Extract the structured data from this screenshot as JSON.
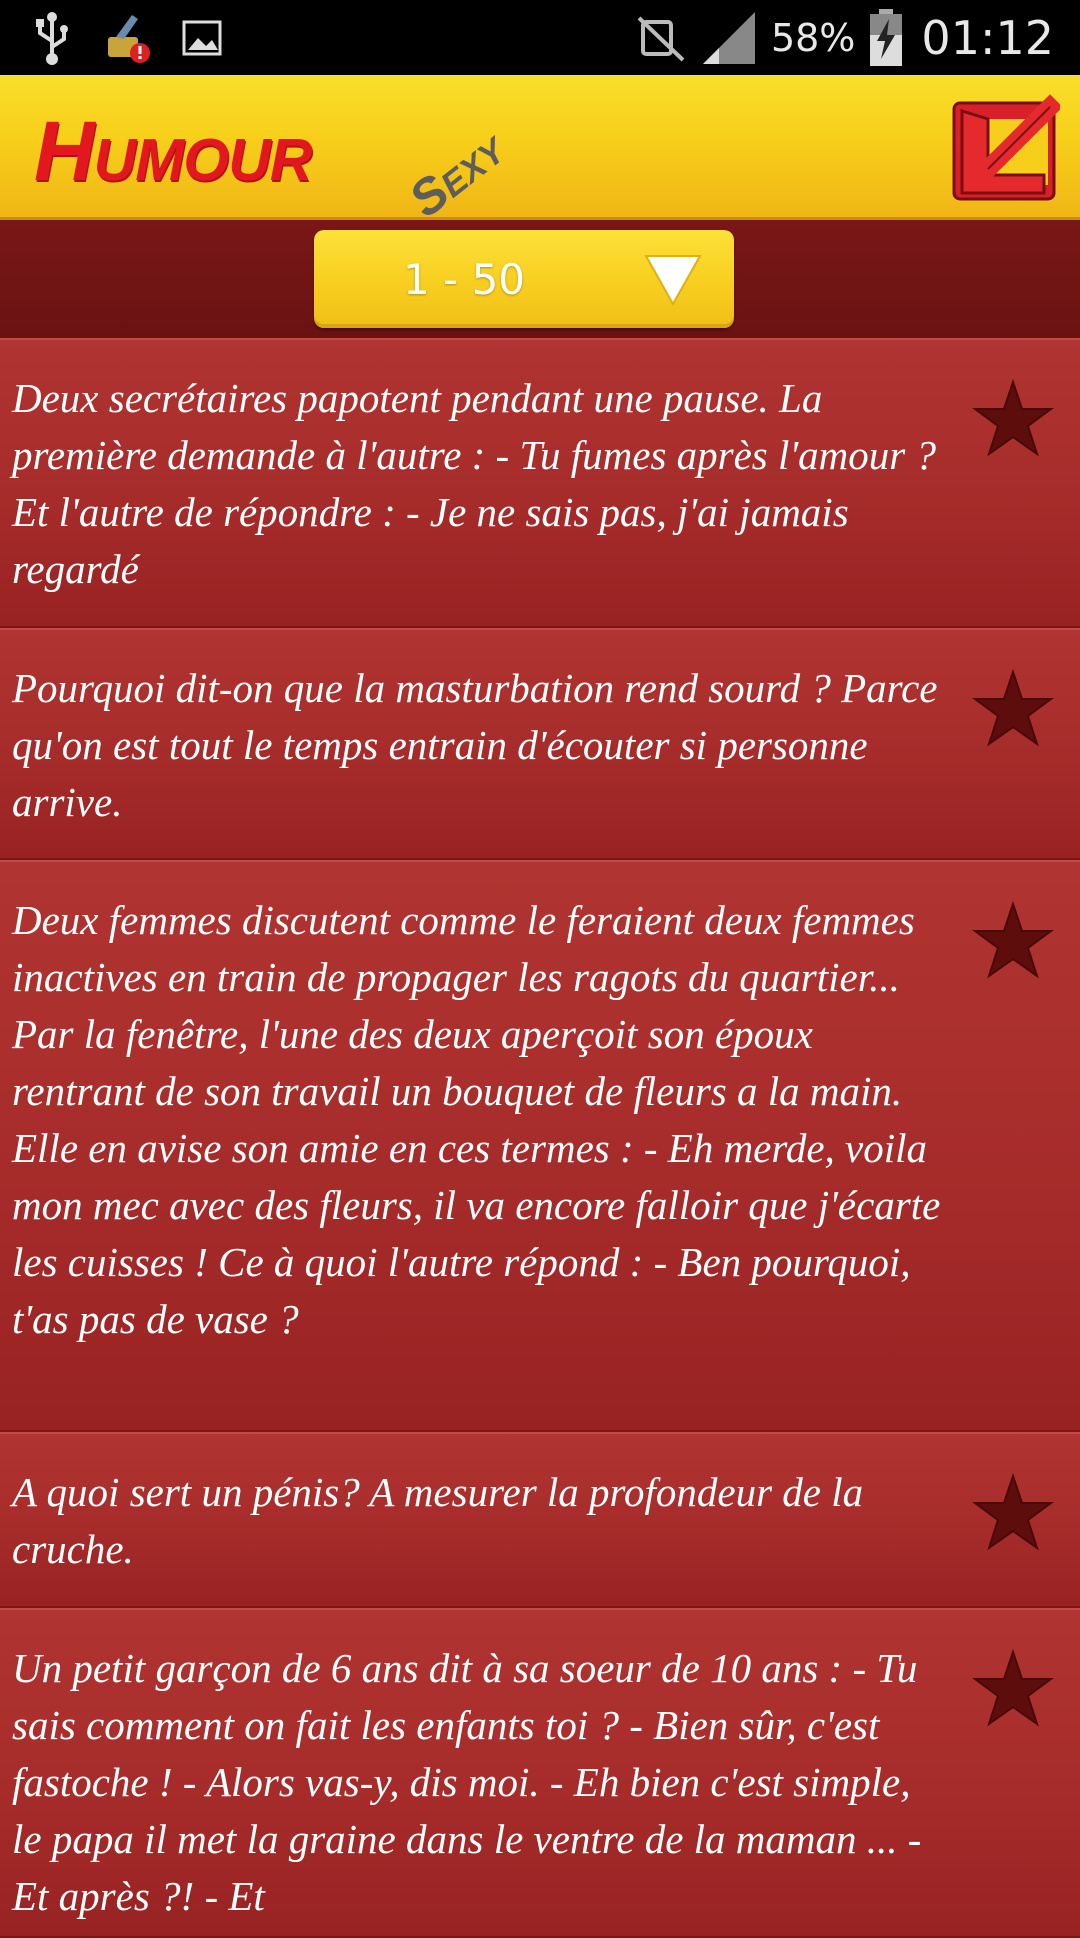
{
  "status_bar": {
    "icons": [
      "usb-icon",
      "cleaner-icon",
      "image-icon",
      "mute-icon",
      "signal-icon",
      "battery-icon"
    ],
    "battery_percent": "58%",
    "time": "01:12"
  },
  "header": {
    "title": "Humour",
    "subtitle": "Sexy",
    "back_icon": "back-arrow-icon",
    "title_color": "#e2181e",
    "accent_color": "#f7cf1a"
  },
  "range_selector": {
    "selected": "1 - 50",
    "arrow_icon": "triangle-down-icon"
  },
  "jokes": [
    {
      "text": "Deux secrétaires papotent pendant une pause. La première demande à l'autre : - Tu fumes après l'amour ? Et l'autre de répondre : - Je ne sais pas, j'ai jamais regardé"
    },
    {
      "text": "Pourquoi dit-on que la masturbation rend sourd ? Parce qu'on est tout le temps entrain d'écouter si personne arrive."
    },
    {
      "text": "Deux femmes discutent comme le feraient deux femmes inactives en train de propager les ragots du quartier... Par la fenêtre, l'une des deux aperçoit son époux rentrant de son travail un bouquet de fleurs a la main. Elle en avise son amie en ces termes : - Eh merde, voila mon mec avec des fleurs, il va encore falloir que j'écarte les cuisses ! Ce à quoi l'autre répond : - Ben pourquoi, t'as pas de vase ?"
    },
    {
      "text": "A quoi sert un pénis? A mesurer la profondeur de la cruche."
    },
    {
      "text": "Un petit garçon de 6 ans dit à sa soeur de 10 ans : - Tu sais comment on fait les enfants toi ? - Bien sûr, c'est fastoche ! - Alors vas-y, dis moi. - Eh bien c'est simple, le papa il met la graine dans le ventre de la maman ... - Et après ?! - Et"
    }
  ],
  "favorite_icon": "star-icon"
}
